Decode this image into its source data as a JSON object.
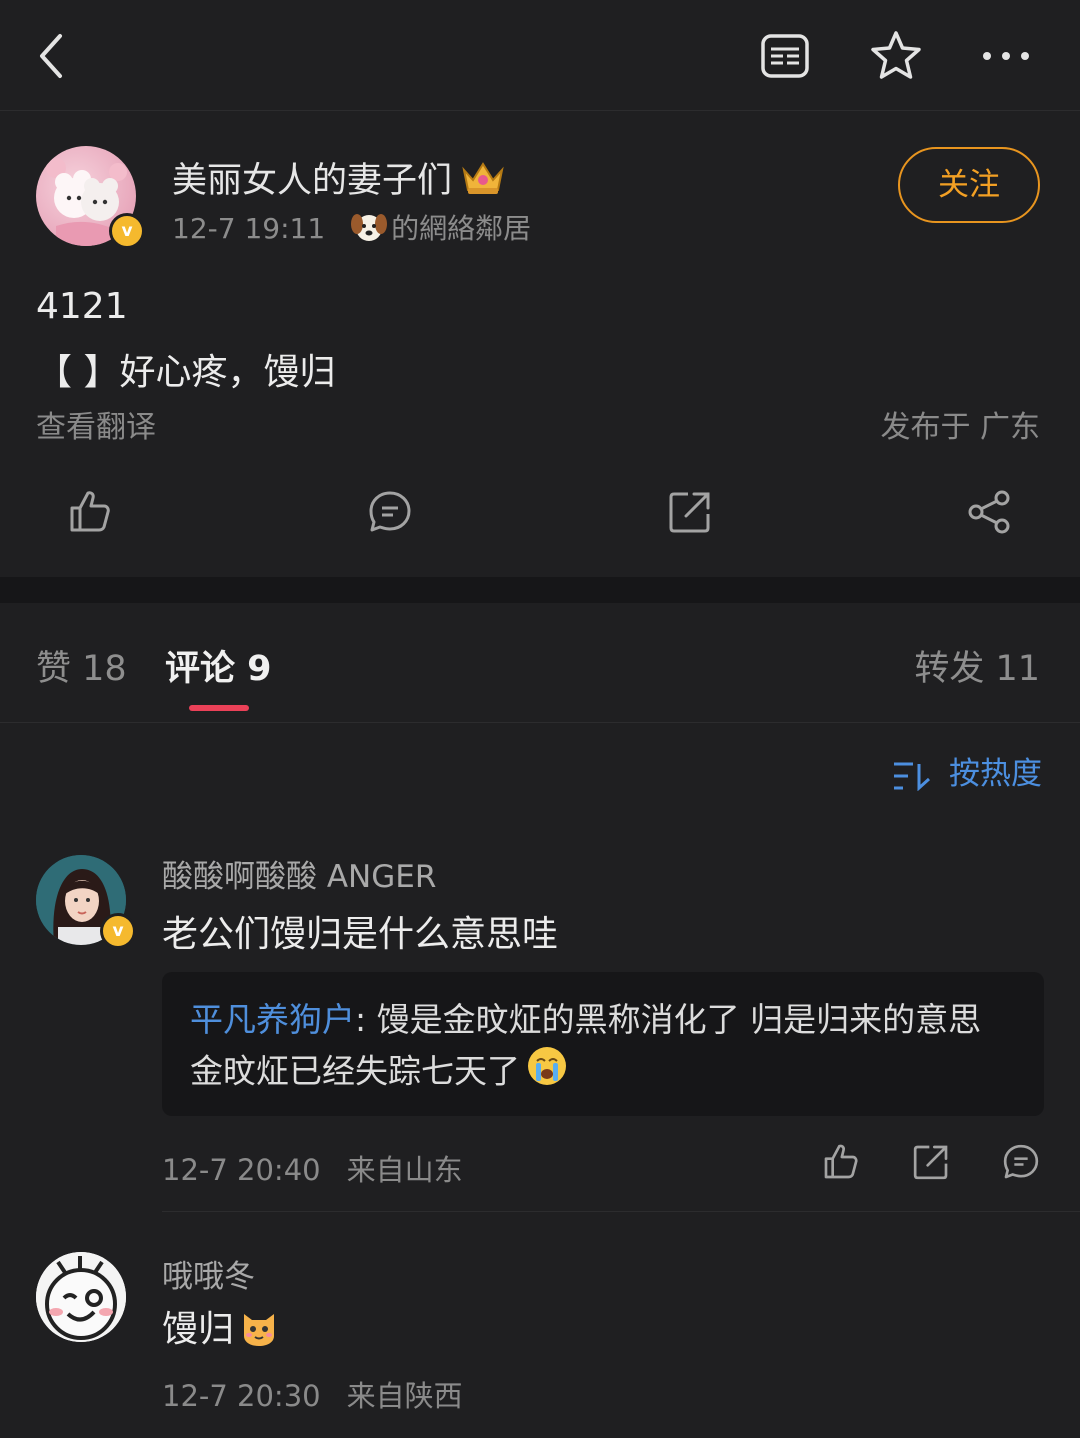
{
  "topbar": {
    "back_icon": "chevron-left-icon",
    "actions": [
      "reader-mode-icon",
      "star-icon",
      "more-icon"
    ]
  },
  "post": {
    "author": "美丽女人的妻子们",
    "time": "12-7 19:11",
    "source": "的網絡鄰居",
    "follow_label": "关注",
    "lines": [
      "4121",
      "【 】好心疼，馒归"
    ],
    "translate_label": "查看翻译",
    "location": "发布于 广东",
    "actions": [
      "like-icon",
      "comment-icon",
      "repost-icon",
      "share-icon"
    ]
  },
  "tabs": [
    {
      "label": "赞 18"
    },
    {
      "label": "评论 9"
    },
    {
      "label": "转发 11"
    }
  ],
  "sort": {
    "label": "按热度"
  },
  "comments": [
    {
      "user": "酸酸啊酸酸 ANGER",
      "text": "老公们馒归是什么意思哇",
      "reply": {
        "user": "平凡养狗户",
        "text": ": 馒是金旼炡的黑称消化了  归是归来的意思  金旼炡已经失踪七天了"
      },
      "time": "12-7 20:40",
      "location": "来自山东"
    },
    {
      "user": "哦哦冬",
      "text": "馒归",
      "time": "12-7 20:30",
      "location": "来自陕西"
    }
  ],
  "colors": {
    "background": "#1f1f21",
    "accent_orange": "#f3a024",
    "link_blue": "#4f8fdc",
    "tab_indicator": "#ea4158",
    "verified": "#f5b92e"
  }
}
